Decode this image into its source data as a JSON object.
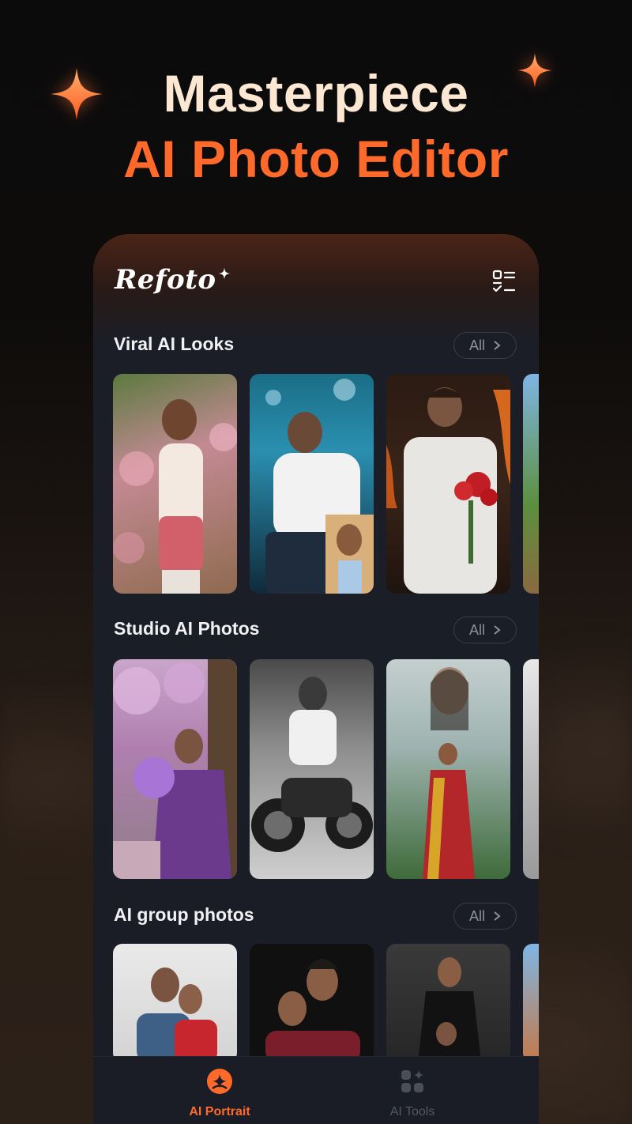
{
  "headline": {
    "line1": "Masterpiece",
    "line2": "AI Photo Editor"
  },
  "app": {
    "logo": "Refoto",
    "menu_icon": "checklist-icon"
  },
  "sections": [
    {
      "title": "Viral AI Looks",
      "all_label": "All"
    },
    {
      "title": "Studio AI Photos",
      "all_label": "All"
    },
    {
      "title": "AI group photos",
      "all_label": "All"
    }
  ],
  "bottom_nav": {
    "items": [
      {
        "label": "AI Portrait",
        "icon": "portrait-sparkle-icon",
        "active": true
      },
      {
        "label": "AI Tools",
        "icon": "tools-grid-icon",
        "active": false
      }
    ]
  },
  "colors": {
    "accent": "#ff6a2b",
    "headline_light": "#fbe7d2",
    "app_background": "#1a1d25"
  }
}
